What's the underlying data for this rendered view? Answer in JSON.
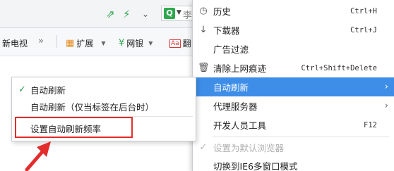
{
  "toolbar": {
    "search_partial": "李",
    "search_engine_icon": "Q"
  },
  "bookmarks": {
    "tv_label": "新电视",
    "more_label": "»",
    "extensions_label": "扩展",
    "bank_label": "网银",
    "last_partial": "翻"
  },
  "menu": {
    "items": [
      {
        "icon": "clock-icon",
        "label": "历史",
        "shortcut": "Ctrl+H"
      },
      {
        "icon": "download-icon",
        "label": "下载器",
        "shortcut": "Ctrl+J"
      },
      {
        "icon": "",
        "label": "广告过滤",
        "shortcut": ""
      },
      {
        "icon": "trash-icon",
        "label": "清除上网痕迹",
        "shortcut": "Ctrl+Shift+Delete"
      },
      {
        "icon": "",
        "label": "自动刷新",
        "shortcut": "",
        "highlighted": true,
        "submenu": true
      },
      {
        "icon": "",
        "label": "代理服务器",
        "shortcut": "",
        "submenu": true
      },
      {
        "icon": "",
        "label": "开发人员工具",
        "shortcut": "F12"
      },
      {
        "icon": "check-icon",
        "label": "设置为默认浏览器",
        "shortcut": "",
        "disabled": true
      },
      {
        "icon": "",
        "label": "切换到IE6多窗口模式",
        "shortcut": ""
      }
    ]
  },
  "submenu": {
    "items": [
      {
        "label": "自动刷新",
        "checked": true
      },
      {
        "label": "自动刷新（仅当标签在后台时）",
        "checked": false
      },
      {
        "label": "设置自动刷新频率",
        "checked": false
      }
    ]
  },
  "colors": {
    "highlight": "#3e8ee8",
    "annotation_red": "#e32c2c",
    "check_green": "#2e9e4e"
  }
}
